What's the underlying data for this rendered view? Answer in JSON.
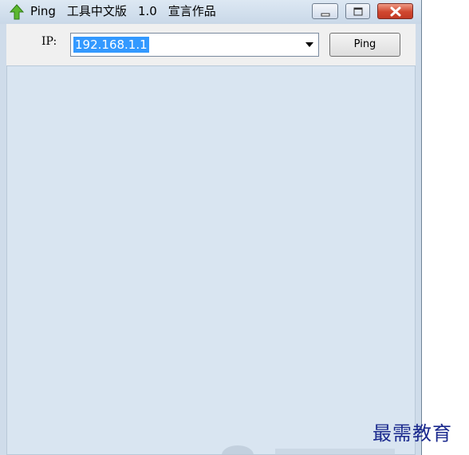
{
  "window": {
    "title_parts": [
      "Ping",
      "工具中文版",
      "1.0",
      "宣言作品"
    ],
    "icon": "green-up-arrow-icon",
    "controls": {
      "minimize_icon": "minimize-icon",
      "maximize_icon": "maximize-icon",
      "close_icon": "close-icon"
    }
  },
  "toolbar": {
    "ip_label": "IP:",
    "ip_value": "192.168.1.1",
    "ping_button_label": "Ping"
  },
  "watermark": {
    "text": "最需教育"
  },
  "colors": {
    "selection": "#3399ff",
    "output_background": "#d9e5f1",
    "close_button": "#d0472f",
    "watermark": "#1b2a8e"
  }
}
